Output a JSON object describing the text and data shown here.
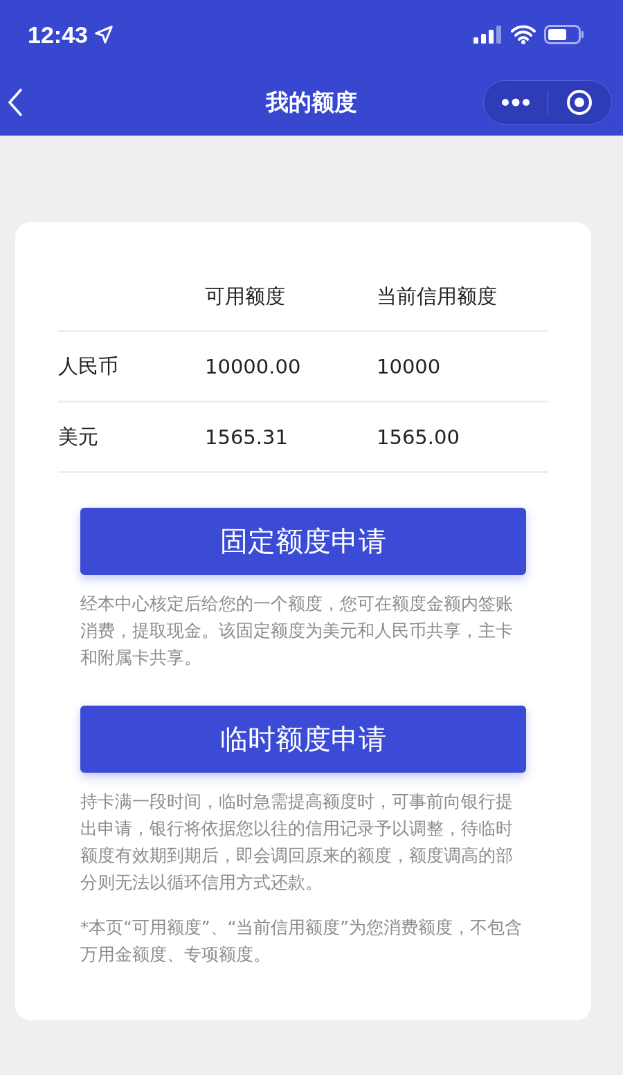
{
  "status_bar": {
    "time": "12:43"
  },
  "nav": {
    "title": "我的额度"
  },
  "table": {
    "columns": [
      "可用额度",
      "当前信用额度"
    ],
    "rows": [
      {
        "currency": "人民币",
        "available": "10000.00",
        "credit": "10000"
      },
      {
        "currency": "美元",
        "available": "1565.31",
        "credit": "1565.00"
      }
    ]
  },
  "sections": [
    {
      "button": "固定额度申请",
      "description": "经本中心核定后给您的一个额度，您可在额度金额内签账消费，提取现金。该固定额度为美元和人民币共享，主卡和附属卡共享。"
    },
    {
      "button": "临时额度申请",
      "description": "持卡满一段时间，临时急需提高额度时，可事前向银行提出申请，银行将依据您以往的信用记录予以调整，待临时额度有效期到期后，即会调回原来的额度，额度调高的部分则无法以循环信用方式还款。"
    }
  ],
  "note": "*本页“可用额度”、“当前信用额度”为您消费额度，不包含万用金额度、专项额度。"
}
